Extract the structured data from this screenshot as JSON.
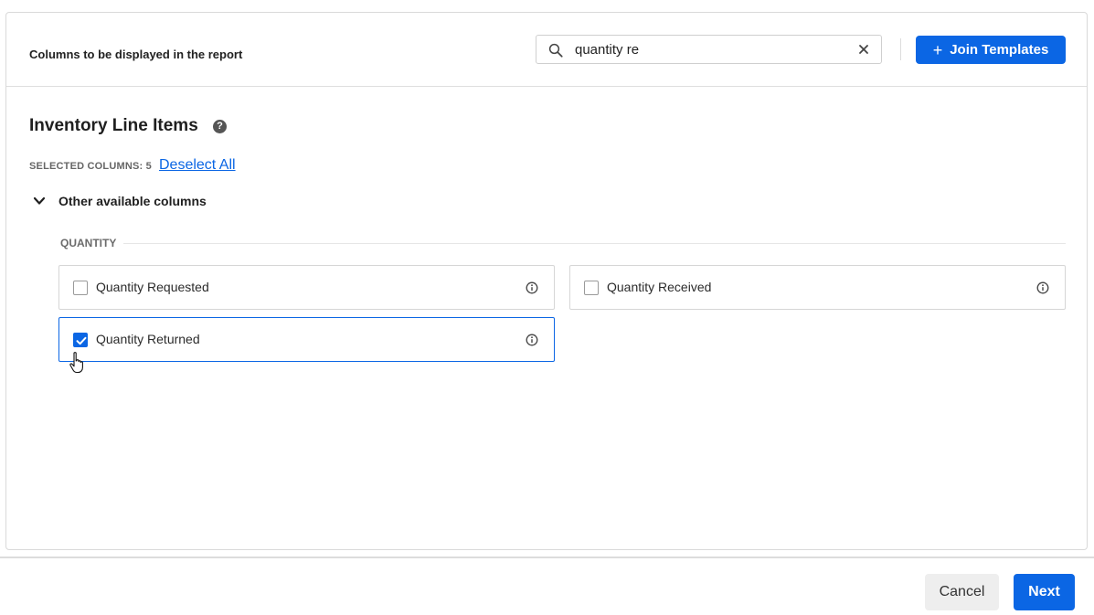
{
  "header": {
    "title": "Columns to be displayed in the report",
    "search": {
      "value": "quantity re",
      "placeholder": ""
    },
    "join_templates_label": "Join Templates"
  },
  "section": {
    "title": "Inventory Line Items",
    "help_icon": "?",
    "selected_label": "SELECTED COLUMNS: 5",
    "deselect_label": "Deselect All",
    "expander_label": "Other available columns"
  },
  "group": {
    "label": "QUANTITY",
    "columns": [
      {
        "label": "Quantity Requested",
        "checked": false
      },
      {
        "label": "Quantity Received",
        "checked": false
      },
      {
        "label": "Quantity Returned",
        "checked": true
      }
    ]
  },
  "footer": {
    "cancel_label": "Cancel",
    "next_label": "Next"
  },
  "colors": {
    "accent": "#0b66e4",
    "border": "#d6d6d6"
  },
  "icons": [
    "search-icon",
    "close-icon",
    "plus-icon",
    "help-icon",
    "chevron-down-icon",
    "info-icon",
    "checkmark-icon",
    "hand-cursor-icon"
  ]
}
